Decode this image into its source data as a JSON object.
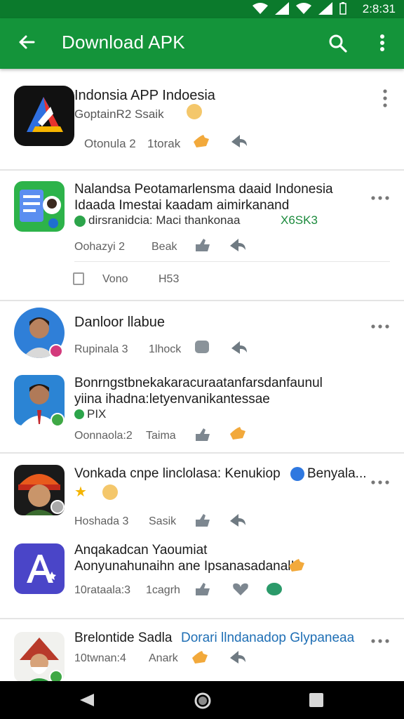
{
  "status_bar": {
    "time": "2:8:31"
  },
  "app_bar": {
    "title": "Download APK",
    "icons": [
      "back-arrow-icon",
      "search-icon",
      "overflow-menu-icon"
    ]
  },
  "items": [
    {
      "line1": "Indonsia APP Indoesia",
      "line2": "GoptainR2  Ssaik",
      "meta_left": "Otonula 2",
      "meta_right": "1torak"
    },
    {
      "line1": "Nalandsa Peotamarlensma daaid Indonesia",
      "line1b": "Idaada Imestai kaadam aimirkanand",
      "line2": "dirsranidcia: Maci thankonaa",
      "line2_tag": "X6SK3",
      "meta_left": "Oohazyi 2",
      "meta_right": "Beak",
      "extra_label": "Vono",
      "extra_value": "H53"
    },
    {
      "line1": "Danloor llabue",
      "meta_left": "Rupinala 3",
      "meta_right": "1lhock"
    },
    {
      "line1": "Bonrngstbnekakaracuraatanfarsdanfaunul",
      "line1b": "yiina ihadna:letyenvanikantessae",
      "line2": "PIX",
      "meta_left": "Oonnaola:2",
      "meta_right": "Taima"
    },
    {
      "line1": "Vonkada cnpe linclolasa: Kenukiop",
      "line1_suffix": "Benyala...",
      "meta_left": "Hoshada 3",
      "meta_right": "Sasik"
    },
    {
      "line1": "Anqakadcan Yaoumiat",
      "line1b": "Aonyunahunaihn ane Ipsanasadanal!",
      "meta_left": "10rataala:3",
      "meta_right": "1cagrh"
    },
    {
      "line1": "Brelontide Sadla",
      "line1_link": "Dorari llndanadop Glypaneaa",
      "meta_left": "10twnan:4",
      "meta_right": "Anark"
    }
  ],
  "colors": {
    "primary": "#14943a",
    "primary_dark": "#0b7a2c",
    "link": "#1f6fb5"
  }
}
